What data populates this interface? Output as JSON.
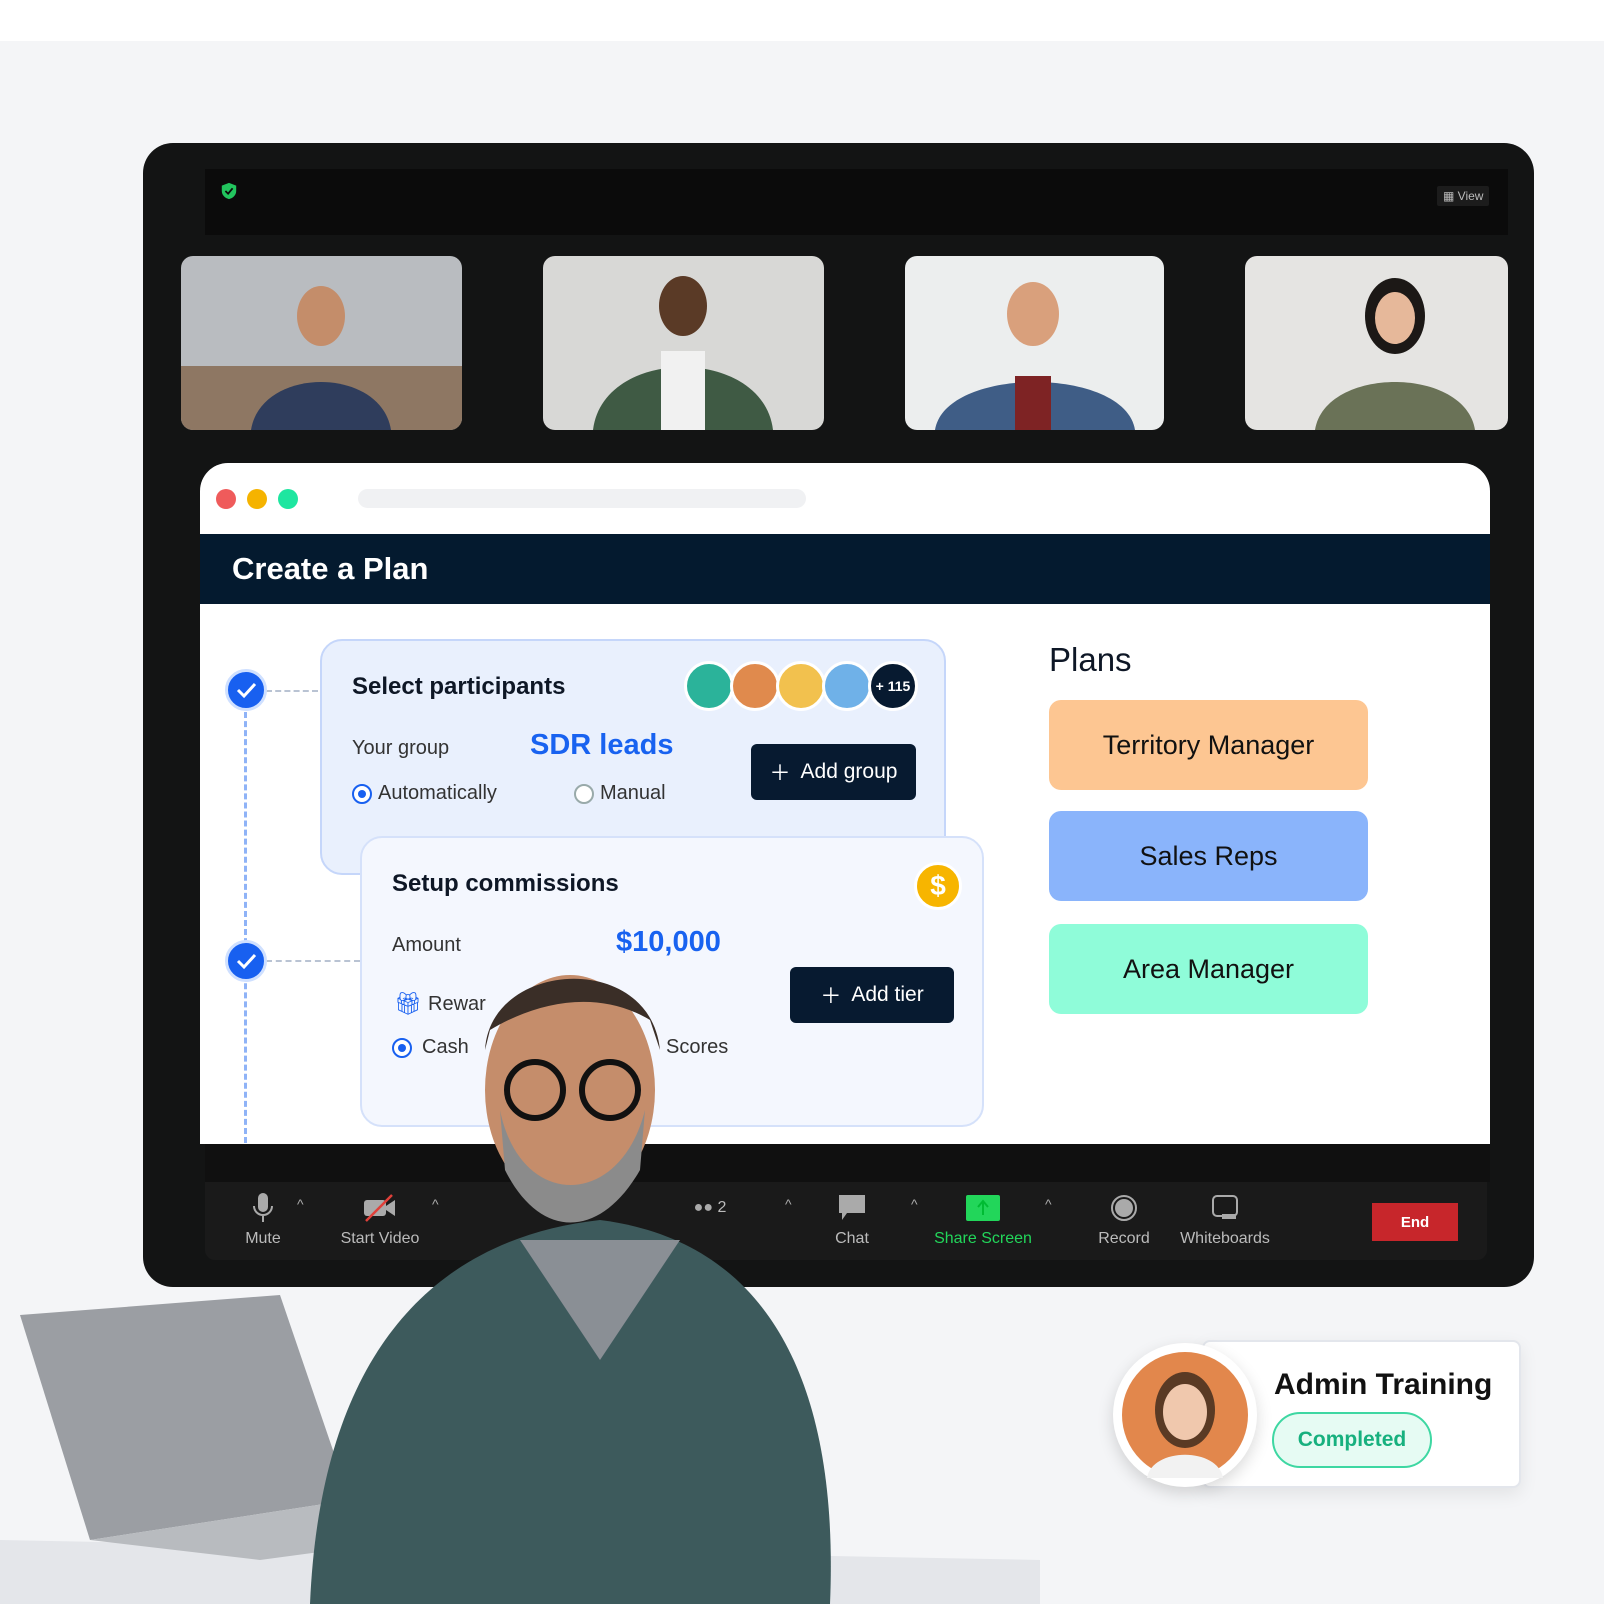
{
  "meeting": {
    "view_label": "View",
    "icons": {
      "security": "shield-check-icon",
      "view": "grid-icon"
    },
    "participant_tiles": [
      "participant-1",
      "participant-2",
      "participant-3",
      "participant-4"
    ]
  },
  "app": {
    "title": "Create a Plan",
    "window_dots": [
      "#ef5b5b",
      "#f5b300",
      "#1ee6a0"
    ],
    "participants_card": {
      "title": "Select participants",
      "extra_count": "+ 115",
      "group_label": "Your group",
      "group_value": "SDR leads",
      "add_group": "Add group",
      "radio_auto": "Automatically",
      "radio_manual": "Manual",
      "selected": "Automatically"
    },
    "commissions_card": {
      "title": "Setup commissions",
      "amount_label": "Amount",
      "amount_value": "$10,000",
      "add_tier": "Add tier",
      "rewards_label": "Rewar",
      "radio_cash": "Cash",
      "radio_scores": "Scores",
      "selected": "Cash"
    },
    "plans": {
      "title": "Plans",
      "items": [
        {
          "label": "Territory Manager",
          "color": "#fdc692"
        },
        {
          "label": "Sales Reps",
          "color": "#8ab4fb"
        },
        {
          "label": "Area Manager",
          "color": "#8ffcd9"
        }
      ]
    }
  },
  "toolbar": {
    "mute": "Mute",
    "start_video": "Start Video",
    "participants_count": "2",
    "chat": "Chat",
    "share_screen": "Share Screen",
    "record": "Record",
    "whiteboards": "Whiteboards",
    "end": "End",
    "accent": "#22d65a"
  },
  "training": {
    "title": "Admin Training",
    "status": "Completed"
  }
}
